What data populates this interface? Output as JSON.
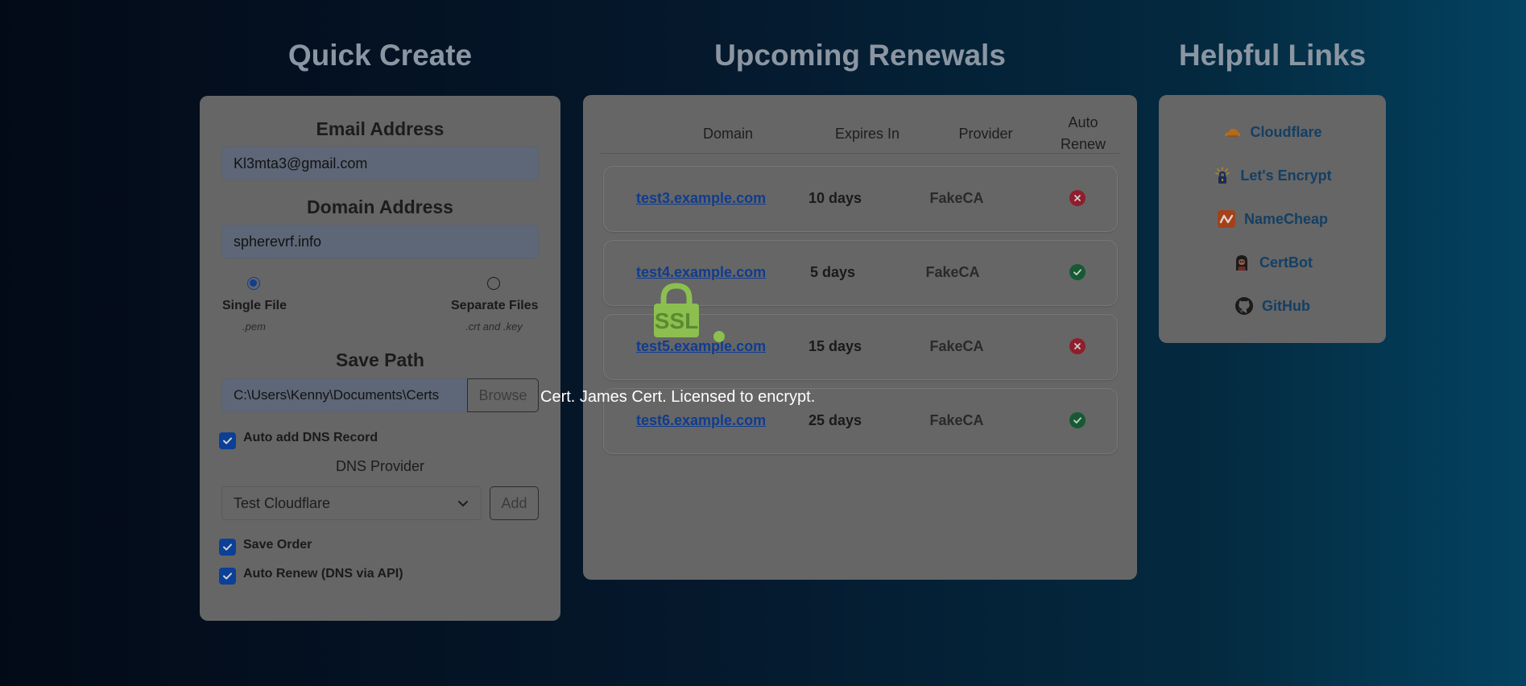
{
  "columns": {
    "quick_create": "Quick Create",
    "renewals": "Upcoming Renewals",
    "links": "Helpful Links"
  },
  "quick_create": {
    "email_label": "Email Address",
    "email_value": "Kl3mta3@gmail.com",
    "domain_label": "Domain Address",
    "domain_value": "spherevrf.info",
    "single_file": {
      "label": "Single File",
      "sub": ".pem",
      "checked": true
    },
    "separate_files": {
      "label": "Separate Files",
      "sub": ".crt and .key",
      "checked": false
    },
    "save_path_label": "Save Path",
    "save_path_value": "C:\\Users\\Kenny\\Documents\\Certs",
    "browse_label": "Browse",
    "auto_dns_label": "Auto add DNS Record",
    "dns_provider_label": "DNS Provider",
    "dns_provider_value": "Test Cloudflare",
    "add_label": "Add",
    "save_order_label": "Save Order",
    "auto_renew_label": "Auto Renew (DNS via API)"
  },
  "renewals": {
    "headers": {
      "domain": "Domain",
      "expires": "Expires In",
      "provider": "Provider",
      "auto_renew_1": "Auto",
      "auto_renew_2": "Renew"
    },
    "rows": [
      {
        "domain": "test3.example.com",
        "expires": "10 days",
        "provider": "FakeCA",
        "auto_renew": false
      },
      {
        "domain": "test4.example.com",
        "expires": "5 days",
        "provider": "FakeCA",
        "auto_renew": true
      },
      {
        "domain": "test5.example.com",
        "expires": "15 days",
        "provider": "FakeCA",
        "auto_renew": false
      },
      {
        "domain": "test6.example.com",
        "expires": "25 days",
        "provider": "FakeCA",
        "auto_renew": true
      }
    ]
  },
  "links": [
    {
      "label": "Cloudflare",
      "icon": "cloudflare-icon"
    },
    {
      "label": "Let's Encrypt",
      "icon": "lets-encrypt-icon"
    },
    {
      "label": "NameCheap",
      "icon": "namecheap-icon"
    },
    {
      "label": "CertBot",
      "icon": "certbot-icon"
    },
    {
      "label": "GitHub",
      "icon": "github-icon"
    }
  ],
  "overlay": {
    "ssl_text": "SSL",
    "tooltip": "Cert. James Cert. Licensed to encrypt."
  },
  "colors": {
    "card": "#666666",
    "accent": "#0c3f97",
    "ok": "#155a33",
    "error": "#8f1e2c",
    "ssl_green": "#8cbf50"
  }
}
